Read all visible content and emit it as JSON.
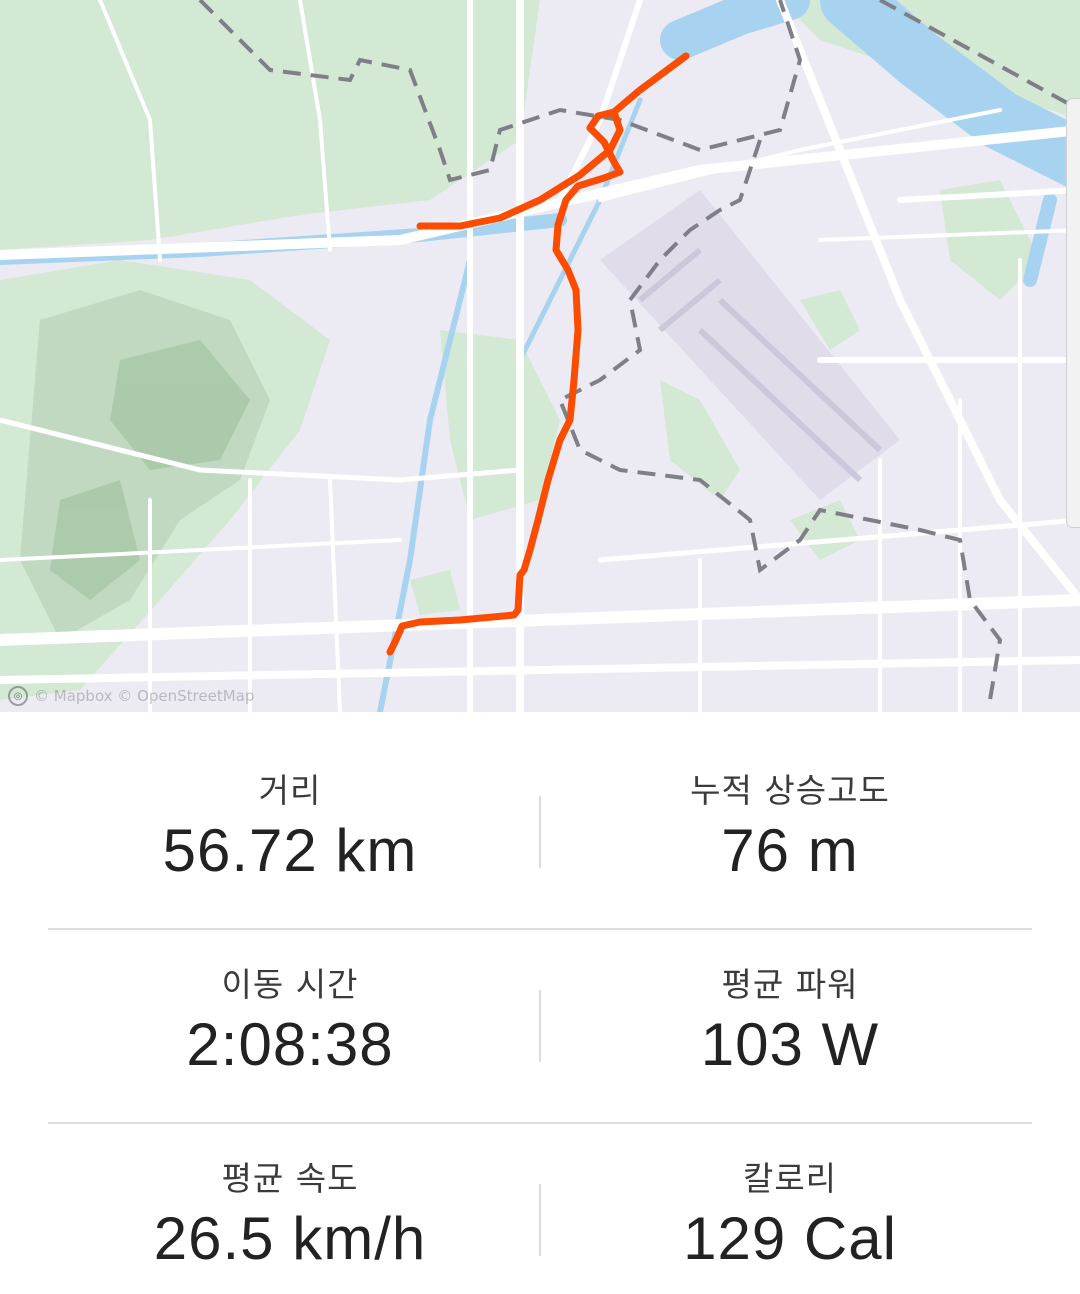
{
  "map": {
    "attribution": "© Mapbox © OpenStreetMap",
    "logo_icon": "mapbox-logo-icon",
    "route_color": "#fc4c02",
    "water_color": "#a7d3f0",
    "park_color": "#cfe8cf",
    "land_color": "#ecebf3",
    "boundary_color": "#888890"
  },
  "stats": [
    [
      {
        "label": "거리",
        "value": "56.72 km"
      },
      {
        "label": "누적 상승고도",
        "value": "76 m"
      }
    ],
    [
      {
        "label": "이동 시간",
        "value": "2:08:38"
      },
      {
        "label": "평균 파워",
        "value": "103 W"
      }
    ],
    [
      {
        "label": "평균 속도",
        "value": "26.5 km/h"
      },
      {
        "label": "칼로리",
        "value": "129 Cal"
      }
    ]
  ]
}
